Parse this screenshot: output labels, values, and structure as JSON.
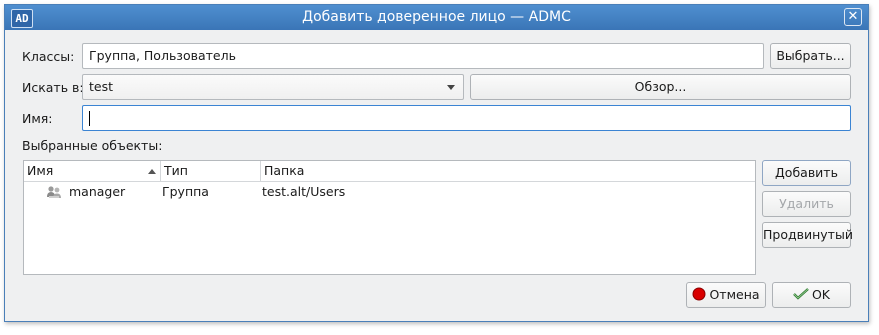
{
  "window": {
    "title": "Добавить доверенное лицо — ADMC",
    "app_icon_text": "AD",
    "close_glyph": "✕"
  },
  "form": {
    "classes_label": "Классы:",
    "classes_value": "Группа, Пользователь",
    "choose_button": "Выбрать...",
    "search_in_label": "Искать в:",
    "search_in_value": "test",
    "browse_button": "Обзор...",
    "name_label": "Имя:",
    "name_value": ""
  },
  "selected": {
    "label": "Выбранные объекты:",
    "columns": [
      "Имя",
      "Тип",
      "Папка"
    ],
    "sort_column": "Имя",
    "rows": [
      {
        "name": "manager",
        "type": "Группа",
        "folder": "test.alt/Users",
        "icon": "group-icon"
      }
    ]
  },
  "side_buttons": {
    "add": "Добавить",
    "remove": "Удалить",
    "advanced": "Продвинутый"
  },
  "footer": {
    "cancel": "Отмена",
    "ok": "OK"
  },
  "colors": {
    "titlebar": "#3a75b7",
    "window_bg": "#eff0f1",
    "focus": "#3b84d3",
    "cancel_icon": "#d90000",
    "ok_icon": "#2f7a2f"
  }
}
